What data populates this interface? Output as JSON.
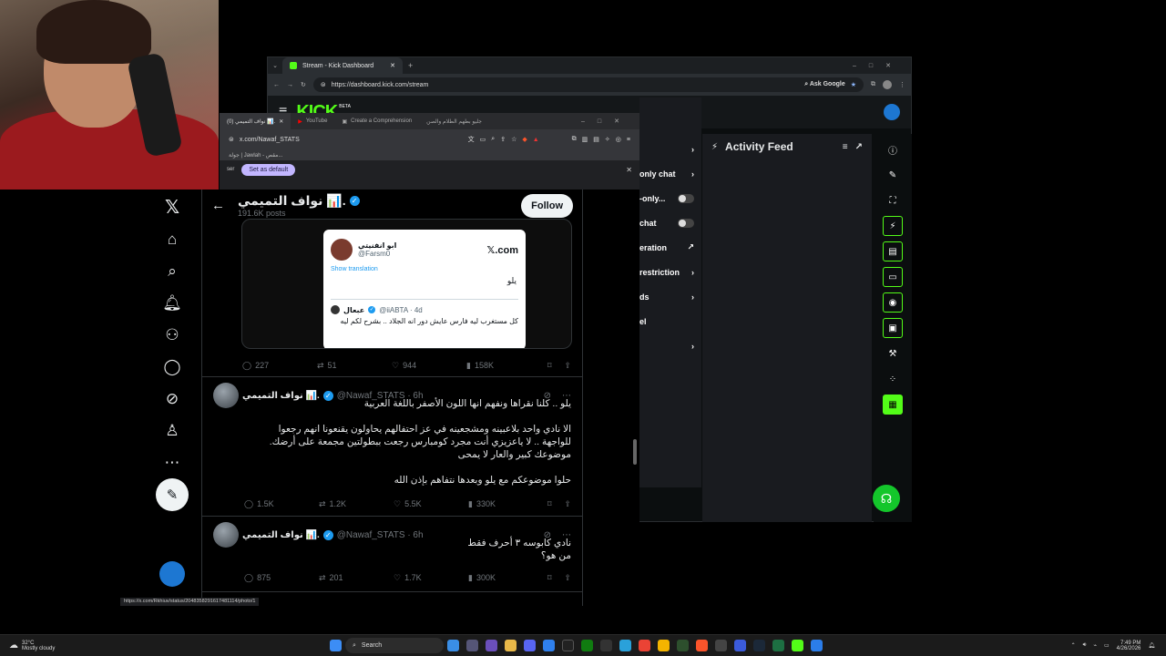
{
  "kick": {
    "tab_title": "Stream - Kick Dashboard",
    "url": "https://dashboard.kick.com/stream",
    "ask_google": "Ask Google",
    "logo": "KICK",
    "logo_badge": "BETA",
    "channel_header": "nel\nns",
    "channel_items": [
      "only chat",
      "-only...",
      "chat",
      "eration",
      "restriction",
      "ds",
      "el"
    ],
    "activity_title": "Activity Feed"
  },
  "xbrowser": {
    "tabs": [
      "(0) نواف التميمي 📊.",
      "YouTube",
      "Create a Comprehension",
      "جليو بطهم الطلام والصن"
    ],
    "url": "x.com/Nawaf_STATS",
    "bookmark": "جولة | Jawlah - مقص...",
    "notice_label": "ser",
    "default_button": "Set as default"
  },
  "profile": {
    "name": "نواف التميمي 📊.",
    "posts": "191.6K posts",
    "follow_label": "Follow"
  },
  "embed": {
    "name": "ابو انفنيتي",
    "handle": "@Farsm0",
    "brand": "𝕏.com",
    "show_translation": "Show translation",
    "text": "يلو",
    "quote_name": "عبعال",
    "quote_handle": "@iiABTA · 4d",
    "quote_text": "كل مستغرب ليه فارس عايش دور انه الجلاد .. بشرح لكم ليه"
  },
  "tweets": [
    {
      "replies": "227",
      "reposts": "51",
      "likes": "944",
      "views": "158K"
    },
    {
      "name": "نواف التميمي 📊.",
      "handle": "@Nawaf_STATS · 6h",
      "p1": "يلو .. كلنا نقراها ونفهم انها اللون الأصفر باللغة العربية",
      "p2": "الا نادي واحد بلاعبينه ومشجعينه في عز احتفالهم يحاولون يقنعونا انهم رجعوا للواجهة .. لا ياعزيزي أنت مجرد كومبارس رجعت ببطولتين مجمعة على أرضك. موضوعك كبير والعار لا يمحى",
      "p3": "حلوا موضوعكم مع يلو وبعدها نتفاهم بإذن الله",
      "replies": "1.5K",
      "reposts": "1.2K",
      "likes": "5.5K",
      "views": "330K"
    },
    {
      "name": "نواف التميمي 📊.",
      "handle": "@Nawaf_STATS · 6h",
      "p1": "نادي كابوسه ٣ أحرف فقط",
      "p2": "من هو؟",
      "replies": "875",
      "reposts": "201",
      "likes": "1.7K",
      "views": "300K"
    }
  ],
  "status_url": "https://x.com/Rkhiuv/status/2048358291617481114/photo/1",
  "taskbar": {
    "weather_temp": "32°C",
    "weather_desc": "Mostly cloudy",
    "search": "Search",
    "time": "7:49 PM",
    "date": "4/26/2026"
  },
  "colors": {
    "kick_green": "#53fc18",
    "x_blue": "#1d9bf0",
    "x_bg": "#000000"
  }
}
